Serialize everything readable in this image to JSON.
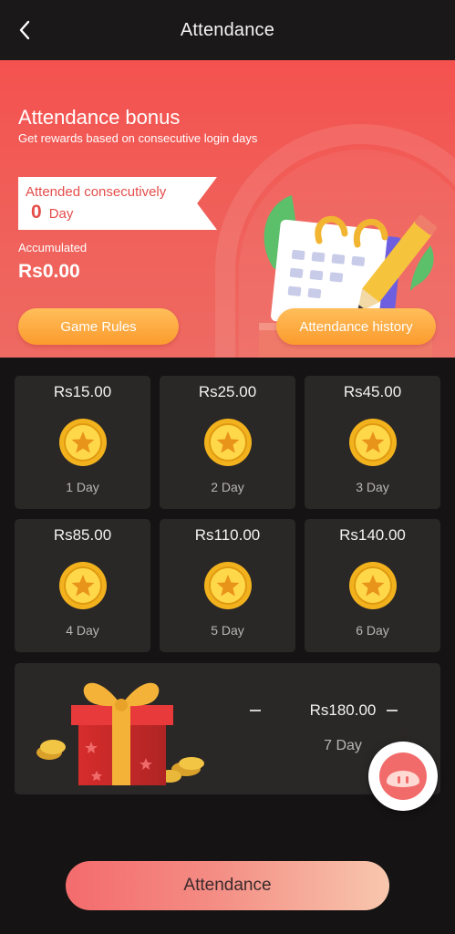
{
  "header": {
    "title": "Attendance",
    "back_icon": "chevron-left-icon"
  },
  "hero": {
    "title": "Attendance bonus",
    "subtitle": "Get rewards based on consecutive login days",
    "streak_label": "Attended consecutively",
    "streak_count": "0",
    "streak_unit": "Day",
    "accumulated_label": "Accumulated",
    "accumulated_value": "Rs0.00",
    "rules_button": "Game Rules",
    "history_button": "Attendance history",
    "colors": {
      "background": "#f4524f",
      "button": "#fb9b2e"
    }
  },
  "rewards": [
    {
      "amount": "Rs15.00",
      "day": "1 Day"
    },
    {
      "amount": "Rs25.00",
      "day": "2 Day"
    },
    {
      "amount": "Rs45.00",
      "day": "3 Day"
    },
    {
      "amount": "Rs85.00",
      "day": "4 Day"
    },
    {
      "amount": "Rs110.00",
      "day": "5 Day"
    },
    {
      "amount": "Rs140.00",
      "day": "6 Day"
    }
  ],
  "final_reward": {
    "amount": "Rs180.00",
    "day": "7 Day",
    "icon": "gift-box-icon"
  },
  "float_button": {
    "icon": "support-chat-icon"
  },
  "action": {
    "label": "Attendance"
  }
}
